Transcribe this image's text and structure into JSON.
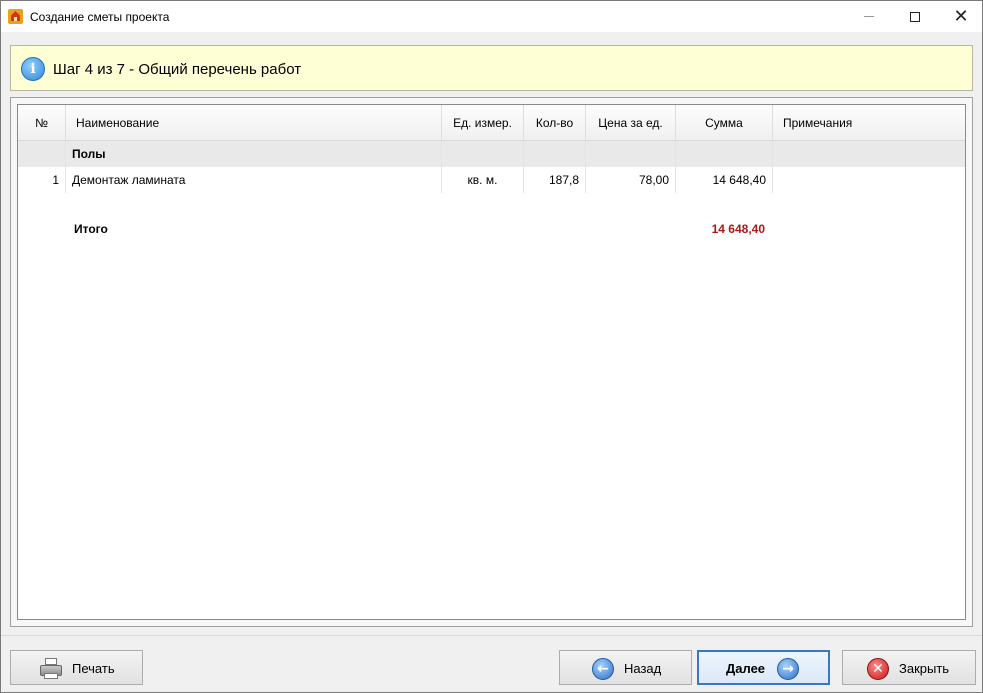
{
  "window": {
    "title": "Создание сметы проекта"
  },
  "banner": {
    "text": "Шаг 4 из 7 - Общий перечень работ"
  },
  "table": {
    "columns": [
      "№",
      "Наименование",
      "Ед. измер.",
      "Кол-во",
      "Цена за ед.",
      "Сумма",
      "Примечания"
    ],
    "group": {
      "name": "Полы"
    },
    "rows": [
      {
        "num": "1",
        "name": "Демонтаж ламината",
        "unit": "кв. м.",
        "qty": "187,8",
        "price": "78,00",
        "sum": "14 648,40",
        "note": ""
      }
    ],
    "total": {
      "label": "Итого",
      "value": "14 648,40",
      "color": "#b01818"
    }
  },
  "buttons": {
    "print": "Печать",
    "back": "Назад",
    "next": "Далее",
    "close": "Закрыть"
  },
  "icons": {
    "app": "house-icon",
    "info": "info-icon",
    "print": "printer-icon",
    "back": "arrow-left-icon",
    "next": "arrow-right-icon",
    "close": "close-icon"
  }
}
